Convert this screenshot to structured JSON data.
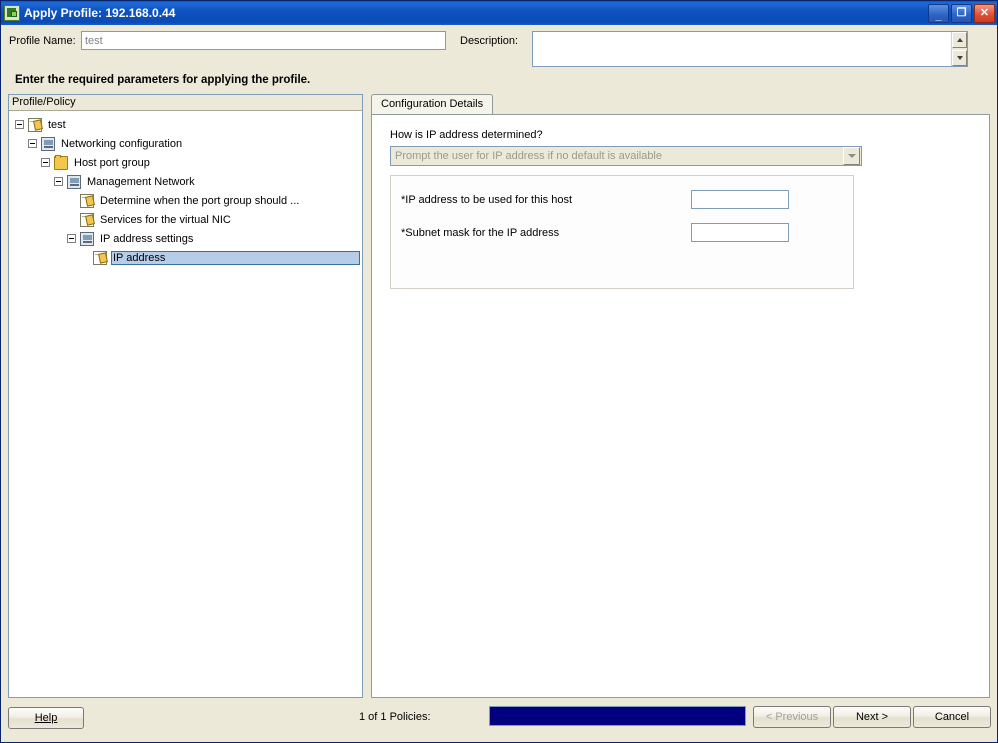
{
  "window": {
    "title": "Apply Profile: 192.168.0.44",
    "icon": "profile-window-icon",
    "buttons": {
      "minimize": "minimize-button",
      "maximize": "maximize-button",
      "close": "close-button"
    }
  },
  "header": {
    "profile_name_label": "Profile Name:",
    "profile_name_value": "test",
    "description_label": "Description:",
    "description_value": "",
    "instruction": "Enter the required parameters for applying the profile."
  },
  "left_pane": {
    "header": "Profile/Policy",
    "tree": [
      {
        "label": "test",
        "indent": 0,
        "expander": "minus",
        "icon": "page-icon",
        "selected": false
      },
      {
        "label": "Networking configuration",
        "indent": 1,
        "expander": "minus",
        "icon": "host-icon",
        "selected": false
      },
      {
        "label": "Host port group",
        "indent": 2,
        "expander": "minus",
        "icon": "folder-icon",
        "selected": false
      },
      {
        "label": "Management Network",
        "indent": 3,
        "expander": "minus",
        "icon": "host-icon",
        "selected": false
      },
      {
        "label": "Determine when the port group should ...",
        "indent": 4,
        "expander": "none",
        "icon": "page-icon",
        "selected": false
      },
      {
        "label": "Services for the virtual NIC",
        "indent": 4,
        "expander": "none",
        "icon": "page-icon",
        "selected": false
      },
      {
        "label": "IP address settings",
        "indent": 4,
        "expander": "minus",
        "icon": "host-icon",
        "selected": false
      },
      {
        "label": "IP address",
        "indent": 5,
        "expander": "none",
        "icon": "page-icon",
        "selected": true
      }
    ]
  },
  "right_pane": {
    "tabs": [
      {
        "label": "Configuration Details",
        "active": true
      }
    ],
    "question_label": "How is IP address determined?",
    "dropdown": {
      "selected": "Prompt the user for IP address if no default is available",
      "enabled": false
    },
    "fields": [
      {
        "label": "*IP address to be used for this host",
        "value": ""
      },
      {
        "label": "*Subnet mask for the IP address",
        "value": ""
      }
    ]
  },
  "footer": {
    "help_label": "Help",
    "policy_count": "1 of 1 Policies:",
    "progress_percent": 100,
    "previous_label": "< Previous",
    "next_label": "Next >",
    "cancel_label": "Cancel"
  },
  "colors": {
    "titlebar_blue": "#0a4bb5",
    "selection_blue": "#b6cde8",
    "progress_navy": "#000080",
    "dialog_face": "#ece9d8"
  }
}
